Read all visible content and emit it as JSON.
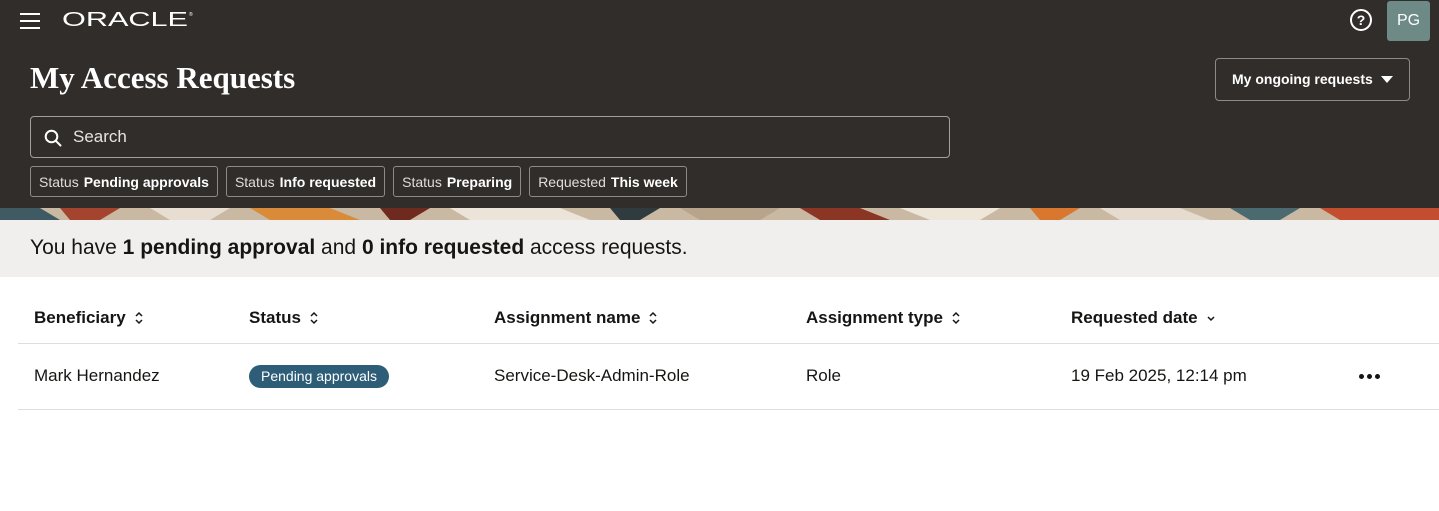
{
  "header": {
    "brand": "ORACLE",
    "avatar_initials": "PG",
    "page_title": "My Access Requests",
    "view_dropdown": "My ongoing requests",
    "search_placeholder": "Search"
  },
  "filter_chips": [
    {
      "key": "Status",
      "value": "Pending approvals"
    },
    {
      "key": "Status",
      "value": "Info requested"
    },
    {
      "key": "Status",
      "value": "Preparing"
    },
    {
      "key": "Requested",
      "value": "This week"
    }
  ],
  "summary": {
    "prefix": "You have",
    "pending_count": "1",
    "pending_label": "pending approval",
    "joiner": "and",
    "info_count": "0",
    "info_label": "info requested",
    "suffix": "access requests."
  },
  "table": {
    "columns": [
      "Beneficiary",
      "Status",
      "Assignment name",
      "Assignment type",
      "Requested date"
    ],
    "rows": [
      {
        "beneficiary": "Mark Hernandez",
        "status": "Pending approvals",
        "assignment_name": "Service-Desk-Admin-Role",
        "assignment_type": "Role",
        "requested_date": "19 Feb 2025, 12:14 pm"
      }
    ]
  },
  "colors": {
    "header_bg": "#312d2a",
    "status_badge": "#2d5d77",
    "summary_bg": "#f1efed",
    "avatar_bg": "#6d8a87"
  },
  "icons": [
    "hamburger-menu-icon",
    "help-icon",
    "search-icon",
    "caret-down-icon",
    "sort-icon",
    "sort-descending-icon",
    "more-options-icon"
  ]
}
